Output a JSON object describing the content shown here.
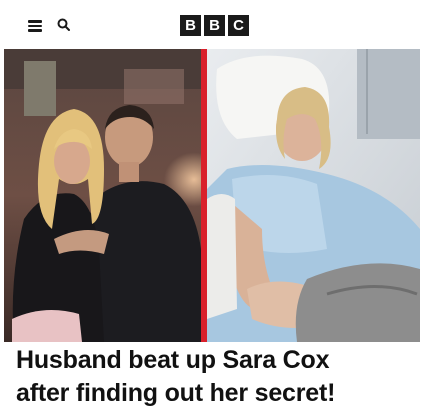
{
  "header": {
    "logo_letters": [
      "B",
      "B",
      "C"
    ],
    "menu_icon": "hamburger-menu-icon",
    "search_icon": "search-icon"
  },
  "article": {
    "headline_line1": "Husband beat up Sara Cox",
    "headline_line2": "after finding out her secret!"
  },
  "colors": {
    "divider": "#d9202b",
    "logo_block": "#1a1a1a",
    "headline": "#111111"
  }
}
